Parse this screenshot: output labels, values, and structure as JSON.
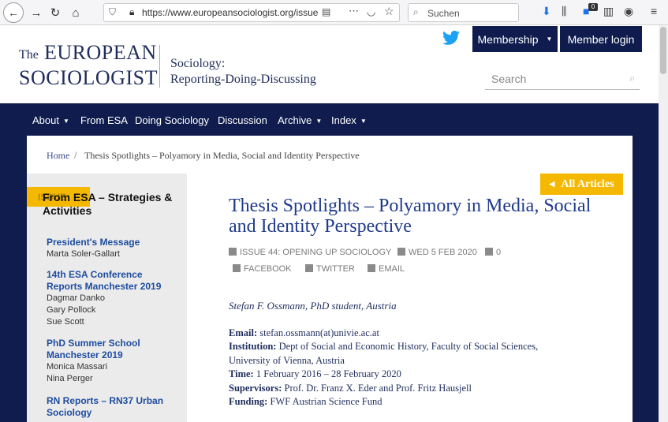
{
  "browser": {
    "url": "https://www.europeansociologist.org/issue",
    "search_placeholder": "Suchen",
    "extension_badge": "0"
  },
  "header": {
    "logo_the": "The",
    "logo_european": "EUROPEAN",
    "logo_sociologist": "SOCIOLOGIST",
    "tagline_1": "Sociology:",
    "tagline_2": "Reporting-Doing-Discussing",
    "membership_label": "Membership",
    "login_label": "Member login",
    "search_placeholder": "Search"
  },
  "nav": {
    "about": "About",
    "from_esa": "From ESA",
    "doing_sociology": "Doing Sociology",
    "discussion": "Discussion",
    "archive": "Archive",
    "index": "Index"
  },
  "breadcrumb": {
    "home": "Home",
    "separator": "/",
    "current": "Thesis Spotlights – Polyamory in Media, Social and Identity Perspective"
  },
  "sidebar": {
    "badge": "ISSUE",
    "title": "From ESA – Strategies & Activities",
    "items": [
      {
        "title": "President's Message",
        "authors": [
          "Marta Soler-Gallart"
        ]
      },
      {
        "title": "14th ESA Conference Reports Manchester 2019",
        "authors": [
          "Dagmar Danko",
          "Gary Pollock",
          "Sue Scott"
        ]
      },
      {
        "title": "PhD Summer School Manchester 2019",
        "authors": [
          "Monica Massari",
          "Nina Perger"
        ]
      },
      {
        "title": "RN Reports – RN37 Urban Sociology",
        "authors": []
      }
    ]
  },
  "article": {
    "all_articles": "All Articles",
    "title": "Thesis Spotlights – Polyamory in Media, Social and Identity Perspective",
    "issue": "ISSUE 44: OPENING UP SOCIOLOGY",
    "date": "WED 5 FEB 2020",
    "comments": "0",
    "share_facebook": "FACEBOOK",
    "share_twitter": "TWITTER",
    "share_email": "EMAIL",
    "author": "Stefan F. Ossmann, PhD student, Austria",
    "email_label": "Email:",
    "email_value": "stefan.ossmann(at)univie.ac.at",
    "institution_label": "Institution:",
    "institution_value_1": "Dept of Social and Economic History, Faculty of Social Sciences,",
    "institution_value_2": "University of Vienna, Austria",
    "time_label": "Time:",
    "time_value": "1 February 2016 – 28 February 2020",
    "supervisors_label": "Supervisors:",
    "supervisors_value": "Prof. Dr. Franz X. Eder and Prof. Fritz Hausjell",
    "funding_label": "Funding:",
    "funding_value": "FWF Austrian Science Fund"
  },
  "colors": {
    "navy": "#0f1c4d",
    "accent_yellow": "#f5b800",
    "title_blue": "#1f3a8a"
  }
}
